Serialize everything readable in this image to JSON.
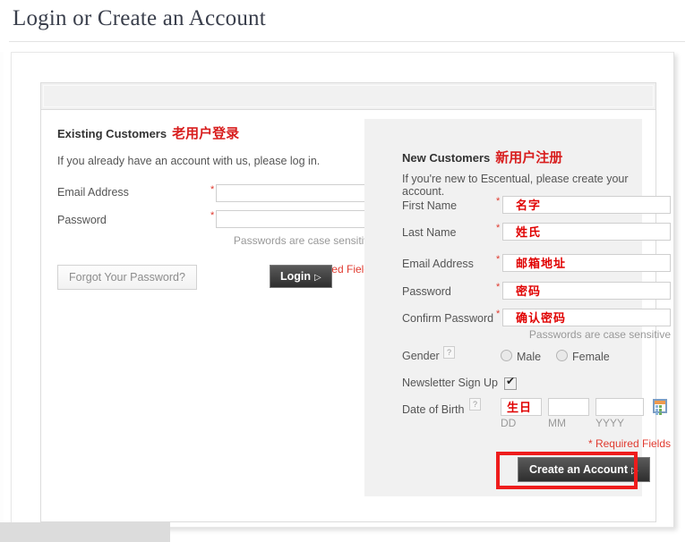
{
  "page": {
    "title": "Login or Create an Account"
  },
  "existing": {
    "heading": "Existing Customers",
    "heading_cn": "老用户登录",
    "intro": "If you already have an account with us, please log in.",
    "email_label": "Email Address",
    "email_value": "",
    "password_label": "Password",
    "password_value": "",
    "required_mark": "*",
    "case_hint": "Passwords are case sensitive",
    "required_note": "* Required Fields",
    "forgot_button": "Forgot Your Password?",
    "login_button": "Login",
    "login_arrow": "▷"
  },
  "newcust": {
    "heading": "New Customers",
    "heading_cn": "新用户注册",
    "intro": "If you're new to Escentual, please create your account.",
    "required_mark": "*",
    "fields": [
      {
        "label": "First Name",
        "value": "名字"
      },
      {
        "label": "Last Name",
        "value": "姓氏"
      },
      {
        "label": "Email Address",
        "value": "邮箱地址"
      },
      {
        "label": "Password",
        "value": "密码"
      },
      {
        "label": "Confirm Password",
        "value": "确认密码"
      }
    ],
    "case_hint": "Passwords are case sensitive",
    "gender_label": "Gender",
    "gender_help": "?",
    "gender_male": "Male",
    "gender_female": "Female",
    "newsletter_label": "Newsletter Sign Up",
    "newsletter_checked": true,
    "dob_label": "Date of Birth",
    "dob_help": "?",
    "dob_day_value": "生日",
    "dob_month_value": "",
    "dob_year_value": "",
    "dob_day_sub": "DD",
    "dob_month_sub": "MM",
    "dob_year_sub": "YYYY",
    "calendar_icon": "calendar-icon",
    "required_note": "* Required Fields",
    "create_button": "Create an Account",
    "create_arrow": "▷"
  },
  "colors": {
    "accent_red": "#e03a2f",
    "cn_red": "#e00000",
    "annotation_red": "#ee1c1c",
    "panel_gray": "#f1f1f1"
  }
}
